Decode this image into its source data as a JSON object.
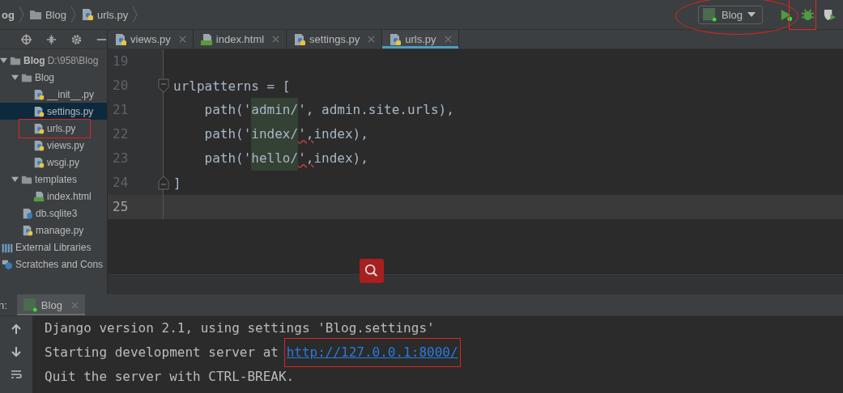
{
  "breadcrumbs": [
    {
      "label": "og",
      "kind": "project"
    },
    {
      "label": "Blog",
      "kind": "folder"
    },
    {
      "label": "urls.py",
      "kind": "py"
    }
  ],
  "run_config": {
    "label": "Blog"
  },
  "editor_tabs": [
    {
      "label": "views.py",
      "kind": "py",
      "selected": false
    },
    {
      "label": "index.html",
      "kind": "html",
      "selected": false
    },
    {
      "label": "settings.py",
      "kind": "py",
      "selected": false
    },
    {
      "label": "urls.py",
      "kind": "py",
      "selected": true
    }
  ],
  "project_tree": [
    {
      "label": "Blog",
      "path": "D:\\958\\Blog",
      "kind": "folder",
      "expanded": true,
      "selected": false,
      "children": [
        {
          "label": "Blog",
          "kind": "folder",
          "expanded": true,
          "selected": false,
          "children": [
            {
              "label": "__init__.py",
              "kind": "py",
              "selected": false
            },
            {
              "label": "settings.py",
              "kind": "py",
              "selected": true
            },
            {
              "label": "urls.py",
              "kind": "py",
              "selected": false
            },
            {
              "label": "views.py",
              "kind": "py",
              "selected": false
            },
            {
              "label": "wsgi.py",
              "kind": "py",
              "selected": false
            }
          ]
        },
        {
          "label": "templates",
          "kind": "folder",
          "expanded": true,
          "selected": false,
          "children": [
            {
              "label": "index.html",
              "kind": "html",
              "selected": false
            }
          ]
        },
        {
          "label": "db.sqlite3",
          "kind": "db",
          "selected": false
        },
        {
          "label": "manage.py",
          "kind": "py",
          "selected": false
        }
      ]
    },
    {
      "label": "External Libraries",
      "kind": "libs",
      "selected": false
    },
    {
      "label": "Scratches and Cons",
      "kind": "scratch",
      "selected": false
    }
  ],
  "code_lines": [
    {
      "number": "19",
      "kind": "code",
      "current": false
    },
    {
      "number": "20",
      "kind": "fold_start",
      "current": false,
      "tokens": [
        {
          "text": "urlpatterns = [",
          "kind": "plain"
        }
      ]
    },
    {
      "number": "21",
      "kind": "code",
      "current": false,
      "tokens": [
        {
          "text": "    path('",
          "kind": "plain"
        },
        {
          "text": "admin/",
          "kind": "match"
        },
        {
          "text": "', admin.site.urls),",
          "kind": "plain"
        }
      ]
    },
    {
      "number": "22",
      "kind": "code",
      "current": false,
      "tokens": [
        {
          "text": "    path('",
          "kind": "plain"
        },
        {
          "text": "index/",
          "kind": "match"
        },
        {
          "text": "',",
          "kind": "warn"
        },
        {
          "text": "index),",
          "kind": "plain"
        }
      ]
    },
    {
      "number": "23",
      "kind": "code",
      "current": false,
      "tokens": [
        {
          "text": "    path('",
          "kind": "plain"
        },
        {
          "text": "hello/",
          "kind": "match"
        },
        {
          "text": "',",
          "kind": "warn"
        },
        {
          "text": "index),",
          "kind": "plain"
        }
      ]
    },
    {
      "number": "24",
      "kind": "fold_end",
      "current": false,
      "tokens": [
        {
          "text": "]",
          "kind": "plain"
        }
      ]
    },
    {
      "number": "25",
      "kind": "code",
      "current": true
    }
  ],
  "run_panel": {
    "label": "n:",
    "tabs": [
      {
        "label": "Blog",
        "selected": true
      }
    ]
  },
  "console_lines": [
    {
      "tokens": [
        {
          "text": "Django version 2.1, using settings 'Blog.settings'",
          "kind": "plain"
        }
      ]
    },
    {
      "tokens": [
        {
          "text": "Starting development server at ",
          "kind": "plain"
        },
        {
          "text": "http://127.0.0.1:8000/",
          "kind": "link"
        }
      ]
    },
    {
      "tokens": [
        {
          "text": "Quit the server with CTRL-BREAK.",
          "kind": "plain"
        }
      ]
    }
  ]
}
